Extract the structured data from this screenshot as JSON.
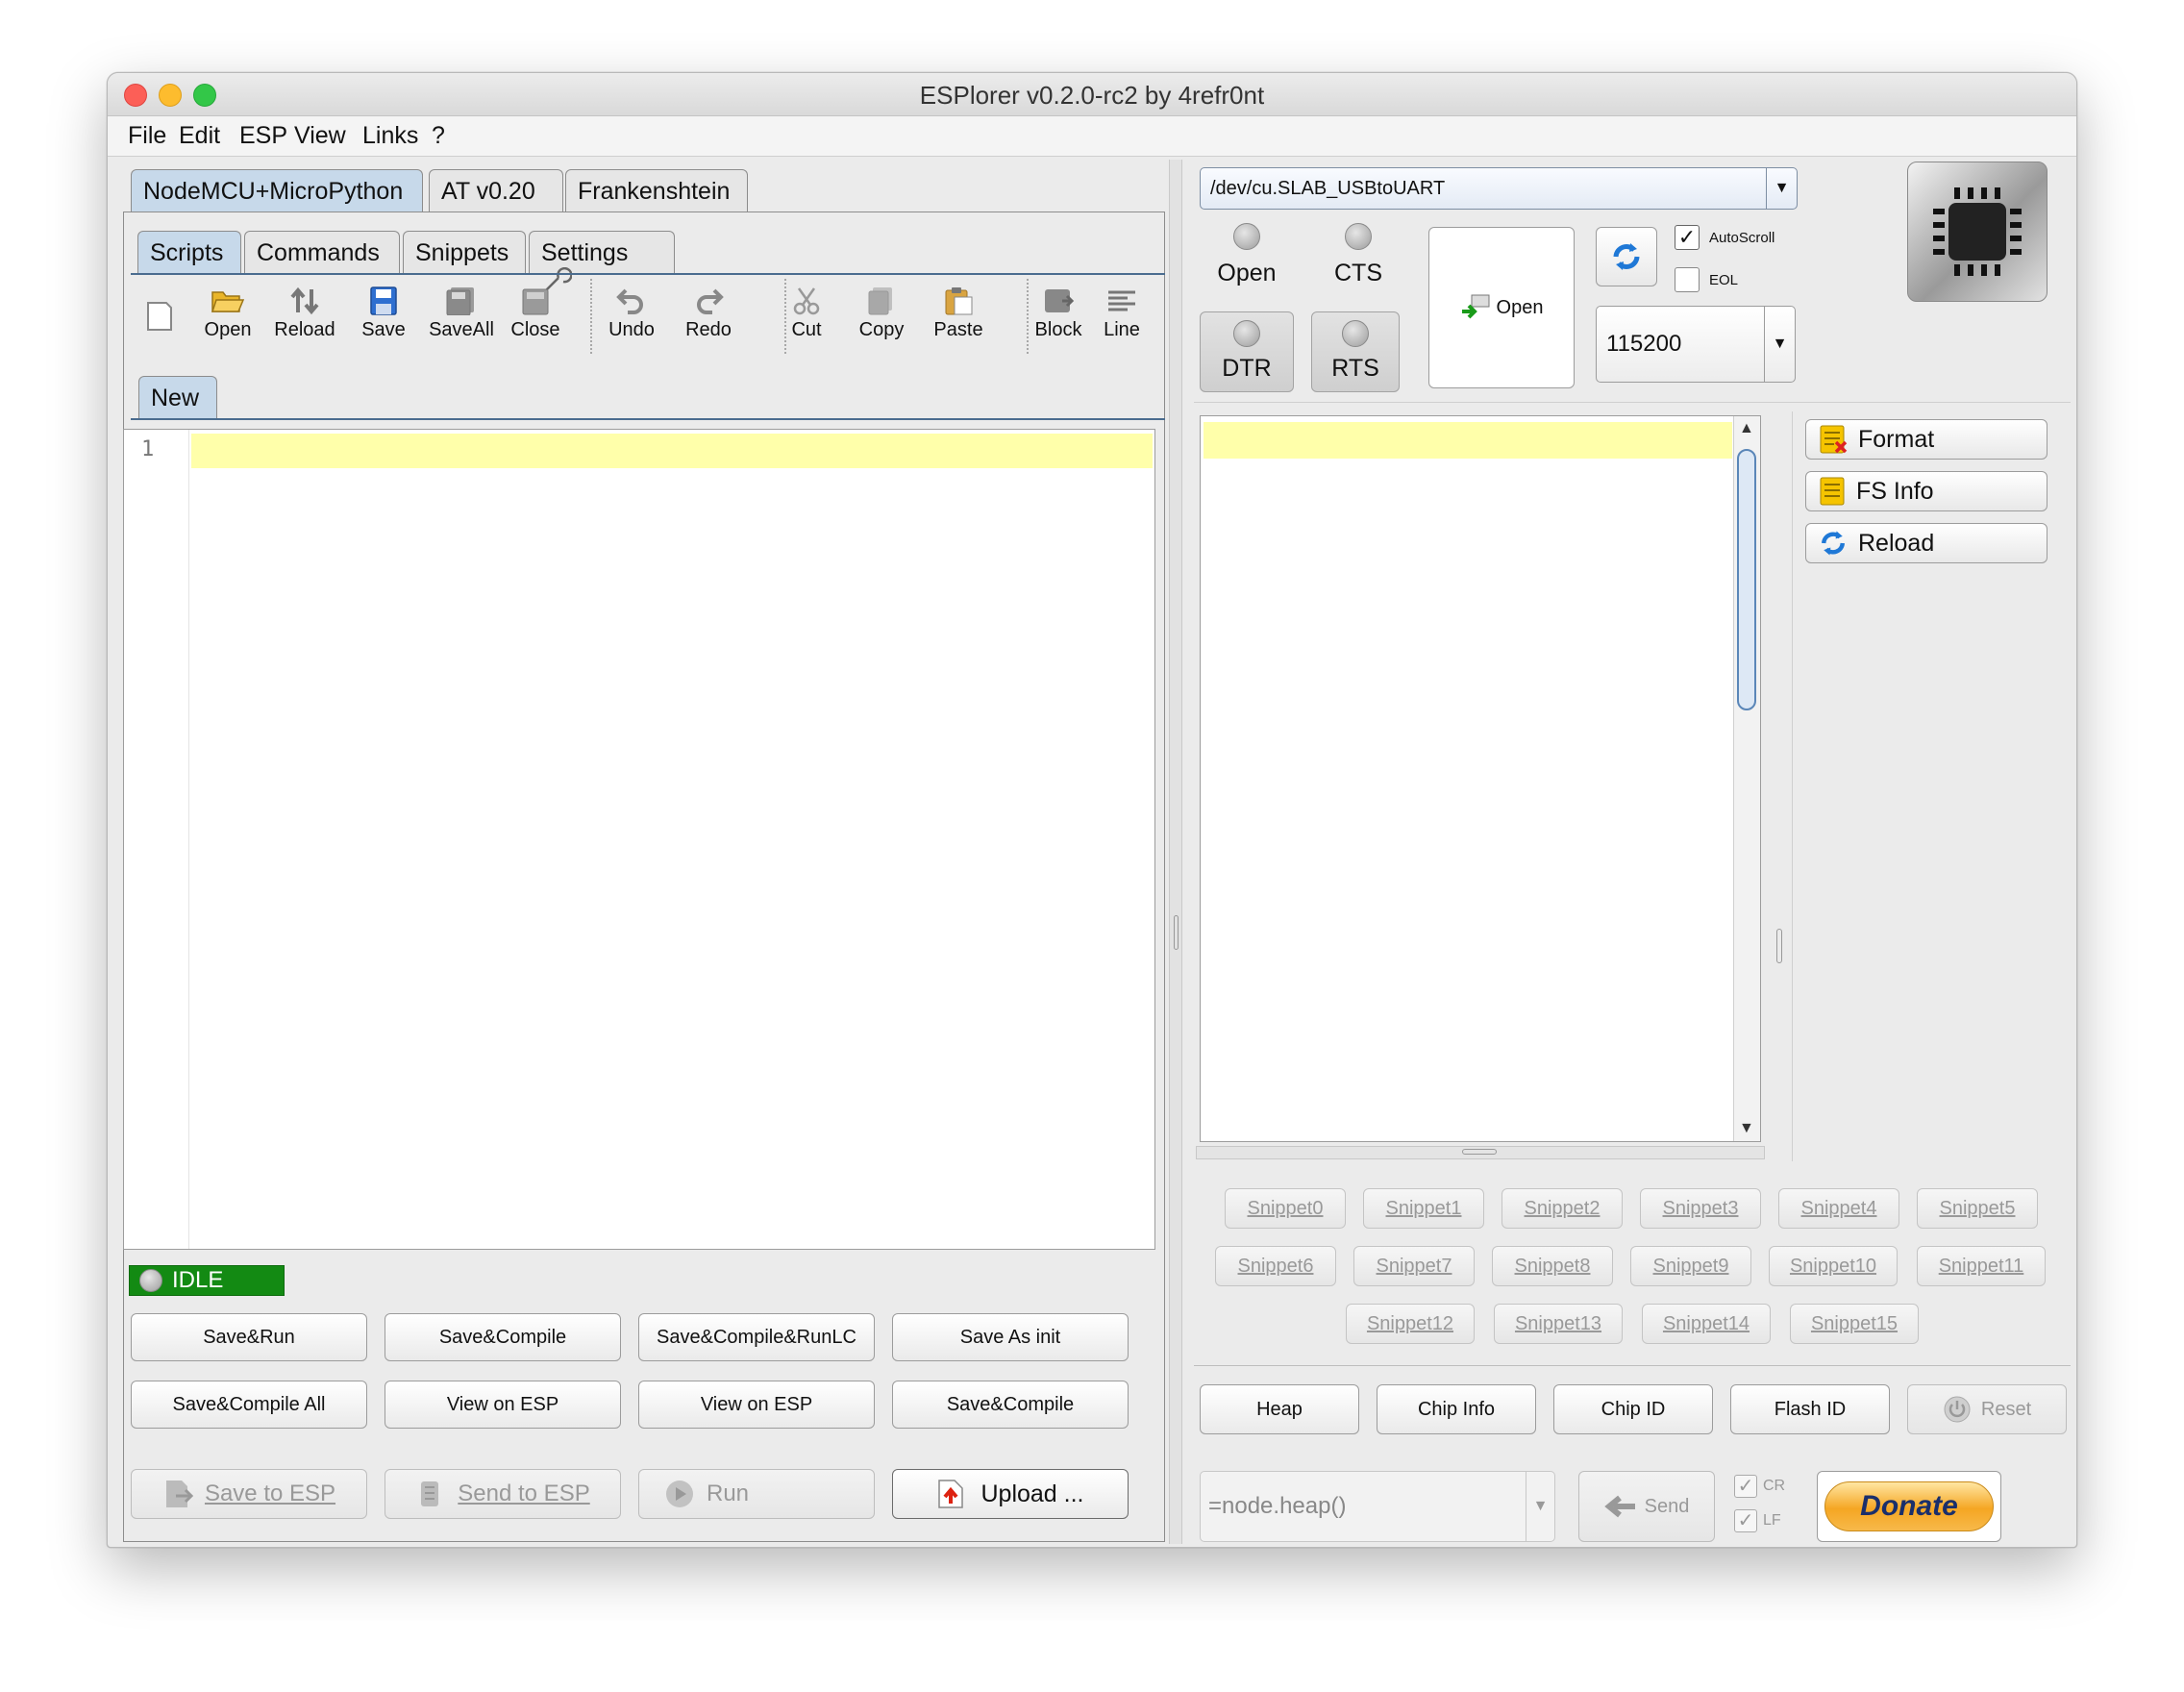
{
  "window": {
    "title": "ESPlorer v0.2.0-rc2 by 4refr0nt"
  },
  "menu": [
    "File",
    "Edit",
    "ESP",
    "View",
    "Links",
    "?"
  ],
  "firmware_tabs": [
    "NodeMCU+MicroPython",
    "AT v0.20",
    "Frankenshtein"
  ],
  "sub_tabs": [
    "Scripts",
    "Commands",
    "Snippets",
    "Settings"
  ],
  "toolbar": [
    "Open",
    "Reload",
    "Save",
    "SaveAll",
    "Close",
    "Undo",
    "Redo",
    "Cut",
    "Copy",
    "Paste",
    "Block",
    "Line"
  ],
  "editor": {
    "tab": "New",
    "line_number": "1"
  },
  "status": "IDLE",
  "script_buttons": [
    "Save&Run",
    "Save&Compile",
    "Save&Compile&RunLC",
    "Save As init",
    "Save&Compile All",
    "View on ESP",
    "View on ESP",
    "Save&Compile"
  ],
  "bottom_buttons": {
    "save_to_esp": "Save to ESP",
    "send_to_esp": "Send to ESP",
    "run": "Run",
    "upload": "Upload ..."
  },
  "port": {
    "value": "/dev/cu.SLAB_USBtoUART"
  },
  "signals": {
    "open": "Open",
    "cts": "CTS",
    "dtr": "DTR",
    "rts": "RTS"
  },
  "open_button": "Open",
  "options": {
    "autoscroll": "AutoScroll",
    "eol": "EOL",
    "autoscroll_checked": true,
    "eol_checked": false
  },
  "baud": "115200",
  "side_buttons": [
    "Format",
    "FS Info",
    "Reload"
  ],
  "snippets": {
    "row1": [
      "Snippet0",
      "Snippet1",
      "Snippet2",
      "Snippet3",
      "Snippet4",
      "Snippet5"
    ],
    "row2": [
      "Snippet6",
      "Snippet7",
      "Snippet8",
      "Snippet9",
      "Snippet10",
      "Snippet11"
    ],
    "row3": [
      "Snippet12",
      "Snippet13",
      "Snippet14",
      "Snippet15"
    ]
  },
  "info_buttons": [
    "Heap",
    "Chip Info",
    "Chip ID",
    "Flash ID",
    "Reset"
  ],
  "command": {
    "value": "=node.heap()",
    "send": "Send",
    "cr": "CR",
    "lf": "LF"
  },
  "donate": "Donate",
  "colors": {
    "status_green": "#138a13",
    "line_highlight": "#ffffaa",
    "tab_active": "#c7d9ea",
    "donate_orange": "#f5a623"
  }
}
